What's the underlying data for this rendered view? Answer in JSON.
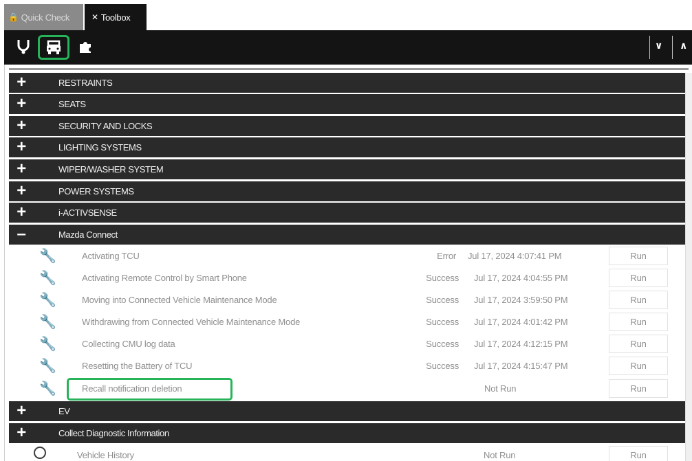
{
  "tabs": [
    {
      "label": "Quick Check",
      "icon": "lock-icon",
      "active": false
    },
    {
      "label": "Toolbox",
      "icon": "tools-icon",
      "active": true
    }
  ],
  "toolbar": {
    "icons": [
      "stethoscope-icon",
      "vehicle-icon",
      "puzzle-icon"
    ],
    "highlight_color": "#27b35a"
  },
  "categories_top": [
    {
      "label": "RESTRAINTS",
      "expanded": false
    },
    {
      "label": "SEATS",
      "expanded": false
    },
    {
      "label": "SECURITY AND LOCKS",
      "expanded": false
    },
    {
      "label": "LIGHTING SYSTEMS",
      "expanded": false
    },
    {
      "label": "WIPER/WASHER SYSTEM",
      "expanded": false
    },
    {
      "label": "POWER SYSTEMS",
      "expanded": false
    },
    {
      "label": "i-ACTIVSENSE",
      "expanded": false
    },
    {
      "label": "Mazda Connect",
      "expanded": true
    }
  ],
  "mazda_connect_items": [
    {
      "name": "Activating TCU",
      "status": "Error",
      "time": "Jul 17, 2024 4:07:41 PM",
      "run": "Run"
    },
    {
      "name": "Activating Remote Control by Smart Phone",
      "status": "Success",
      "time": "Jul 17, 2024 4:04:55 PM",
      "run": "Run"
    },
    {
      "name": "Moving into Connected Vehicle Maintenance Mode",
      "status": "Success",
      "time": "Jul 17, 2024 3:59:50 PM",
      "run": "Run"
    },
    {
      "name": "Withdrawing from Connected Vehicle Maintenance Mode",
      "status": "Success",
      "time": "Jul 17, 2024 4:01:42 PM",
      "run": "Run"
    },
    {
      "name": "Collecting CMU log data",
      "status": "Success",
      "time": "Jul 17, 2024 4:12:15 PM",
      "run": "Run"
    },
    {
      "name": "Resetting the Battery of TCU",
      "status": "Success",
      "time": "Jul 17, 2024 4:15:47 PM",
      "run": "Run"
    },
    {
      "name": "Recall notification deletion",
      "status": "",
      "time": "Not Run",
      "run": "Run",
      "highlighted": true
    }
  ],
  "categories_bottom": [
    {
      "label": "EV",
      "expanded": false
    },
    {
      "label": "Collect Diagnostic Information",
      "expanded": true
    }
  ],
  "diagnostic_items": [
    {
      "name": "Vehicle History",
      "time": "Not Run",
      "run": "Run"
    }
  ]
}
